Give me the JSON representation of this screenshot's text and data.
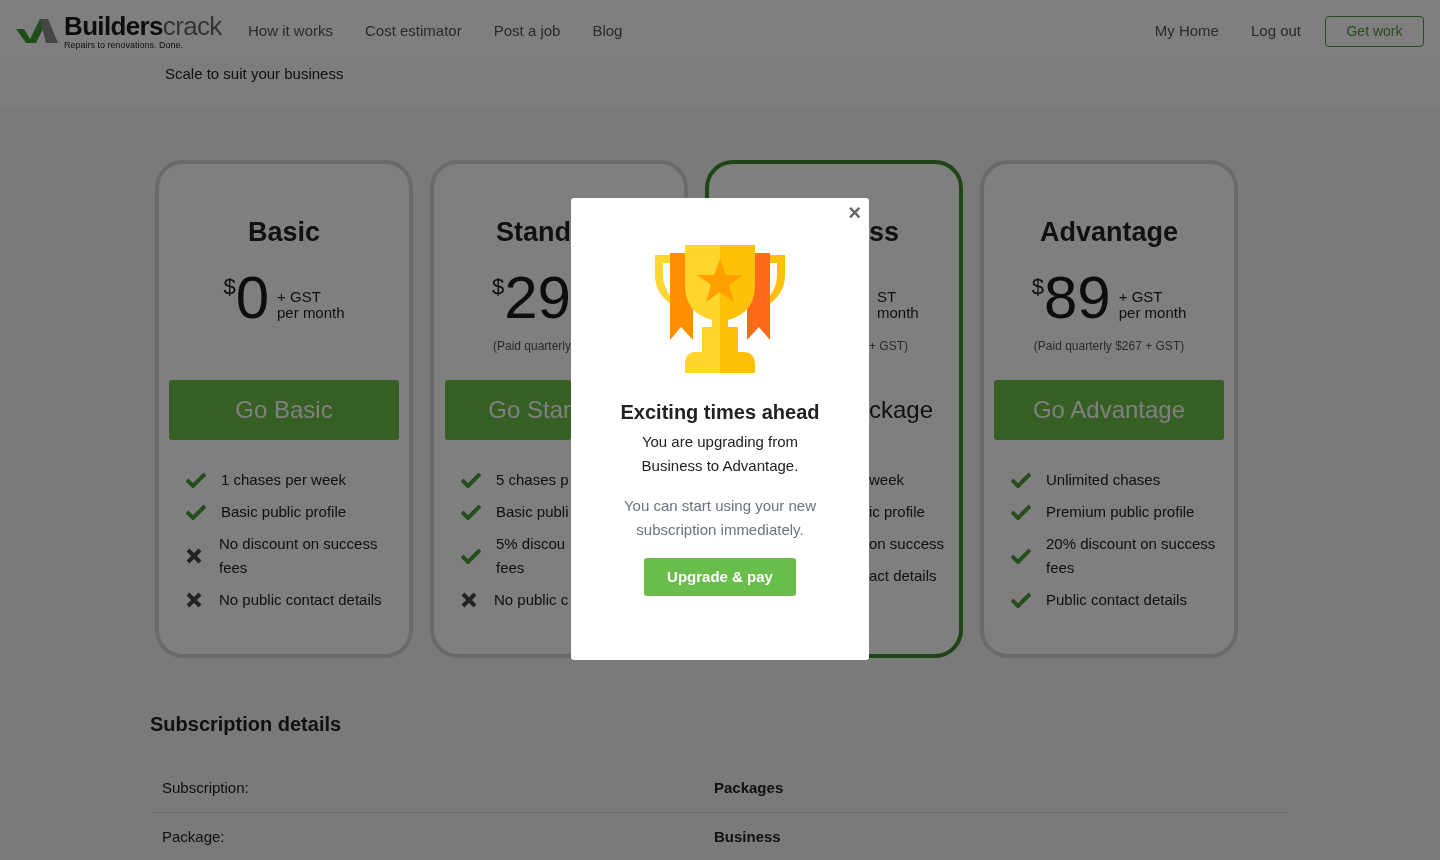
{
  "header": {
    "logo": {
      "brand_bold": "Builders",
      "brand_light": "crack",
      "tagline": "Repairs to renovations. Done."
    },
    "nav": [
      "How it works",
      "Cost estimator",
      "Post a job",
      "Blog"
    ],
    "account_links": [
      "My Home",
      "Log out"
    ],
    "cta": "Get work"
  },
  "subheader": "Scale to suit your business",
  "plans": [
    {
      "kind": "full",
      "current": false,
      "title": "Basic",
      "currency": "$",
      "price": "0",
      "gst": "+ GST",
      "period": "per month",
      "button": "Go Basic",
      "features": [
        {
          "text": "1 chases per week",
          "included": true
        },
        {
          "text": "Basic public profile",
          "included": true
        },
        {
          "text": "No discount on success fees",
          "included": false
        },
        {
          "text": "No public contact details",
          "included": false
        }
      ]
    },
    {
      "kind": "left_part",
      "current": false,
      "title": "Stand",
      "currency": "$",
      "price": "29",
      "note": "(Paid quarterly",
      "button": "Go Star",
      "features": [
        {
          "text": "5 chases p",
          "included": true
        },
        {
          "text": "Basic publi",
          "included": true
        },
        {
          "text": "5% discou\nfees",
          "included": true
        },
        {
          "text": "No public c",
          "included": false
        }
      ]
    },
    {
      "kind": "right_part",
      "current": true,
      "title": "ss",
      "gst": "ST",
      "period": "month",
      "note": "+ GST)",
      "status": "ckage",
      "features": [
        {
          "text": "week"
        },
        {
          "text": "ic profile"
        },
        {
          "text": "on success"
        },
        {
          "text": "act details"
        }
      ]
    },
    {
      "kind": "full",
      "current": false,
      "title": "Advantage",
      "currency": "$",
      "price": "89",
      "gst": "+ GST",
      "period": "per month",
      "note": "(Paid quarterly $267 + GST)",
      "button": "Go Advantage",
      "features": [
        {
          "text": "Unlimited chases",
          "included": true
        },
        {
          "text": "Premium public profile",
          "included": true
        },
        {
          "text": "20% discount on success fees",
          "included": true
        },
        {
          "text": "Public contact details",
          "included": true
        }
      ]
    }
  ],
  "subscription_details": {
    "title": "Subscription details",
    "rows": [
      {
        "label": "Subscription:",
        "value": "Packages"
      },
      {
        "label": "Package:",
        "value": "Business"
      }
    ]
  },
  "modal": {
    "close": "×",
    "title": "Exciting times ahead",
    "message": "You are upgrading from Business to Advantage.",
    "note": "You can start using your new subscription immediately.",
    "button": "Upgrade & pay"
  }
}
